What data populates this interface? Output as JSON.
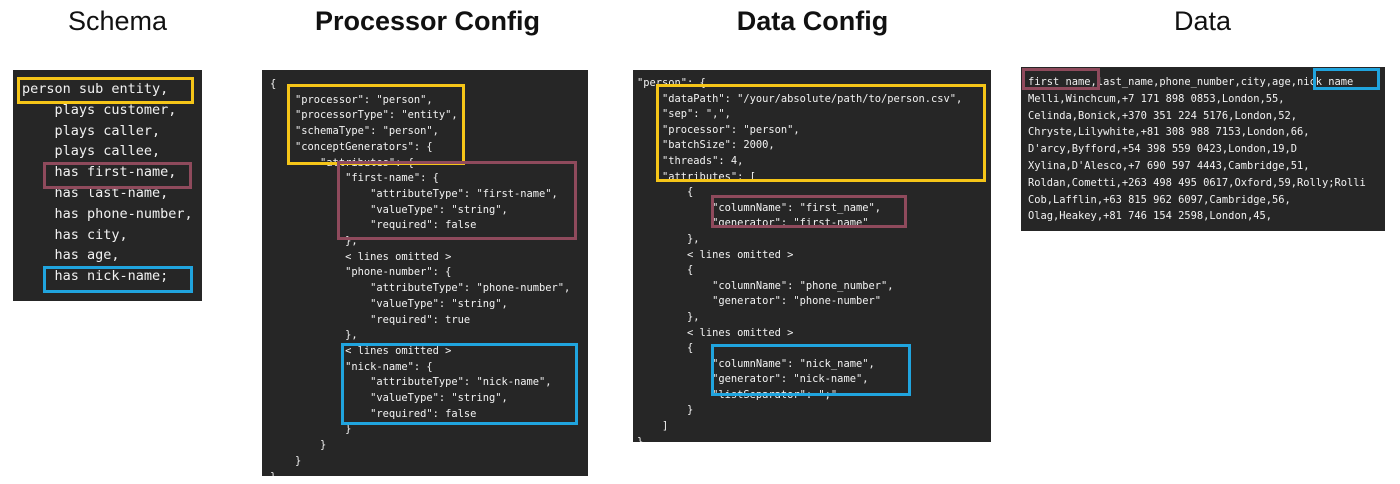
{
  "headings": {
    "schema": "Schema",
    "processor": "Processor Config",
    "dataconfig": "Data Config",
    "data": "Data"
  },
  "colors": {
    "yellow": "#f5c518",
    "red": "#8f4a5c",
    "blue": "#20a4de",
    "panel": "#262626"
  },
  "schema_code": "person sub entity,\n    plays customer,\n    plays caller,\n    plays callee,\n    has first-name,\n    has last-name,\n    has phone-number,\n    has city,\n    has age,\n    has nick-name;",
  "processor_code": "{\n    \"processor\": \"person\",\n    \"processorType\": \"entity\",\n    \"schemaType\": \"person\",\n    \"conceptGenerators\": {\n        \"attributes\": {\n            \"first-name\": {\n                \"attributeType\": \"first-name\",\n                \"valueType\": \"string\",\n                \"required\": false\n            },\n            < lines omitted >\n            \"phone-number\": {\n                \"attributeType\": \"phone-number\",\n                \"valueType\": \"string\",\n                \"required\": true\n            },\n            < lines omitted >\n            \"nick-name\": {\n                \"attributeType\": \"nick-name\",\n                \"valueType\": \"string\",\n                \"required\": false\n            }\n        }\n    }\n}",
  "dataconfig_code": "\"person\": {\n    \"dataPath\": \"/your/absolute/path/to/person.csv\",\n    \"sep\": \",\",\n    \"processor\": \"person\",\n    \"batchSize\": 2000,\n    \"threads\": 4,\n    \"attributes\": [\n        {\n            \"columnName\": \"first_name\",\n            \"generator\": \"first-name\"\n        },\n        < lines omitted >\n        {\n            \"columnName\": \"phone_number\",\n            \"generator\": \"phone-number\"\n        },\n        < lines omitted >\n        {\n            \"columnName\": \"nick_name\",\n            \"generator\": \"nick-name\",\n            \"listSeparator\": \";\"\n        }\n    ]\n}",
  "data_code": "first_name,last_name,phone_number,city,age,nick_name\nMelli,Winchcum,+7 171 898 0853,London,55,\nCelinda,Bonick,+370 351 224 5176,London,52,\nChryste,Lilywhite,+81 308 988 7153,London,66,\nD'arcy,Byfford,+54 398 559 0423,London,19,D\nXylina,D'Alesco,+7 690 597 4443,Cambridge,51,\nRoldan,Cometti,+263 498 495 0617,Oxford,59,Rolly;Rolli\nCob,Lafflin,+63 815 962 6097,Cambridge,56,\nOlag,Heakey,+81 746 154 2598,London,45,\n..."
}
